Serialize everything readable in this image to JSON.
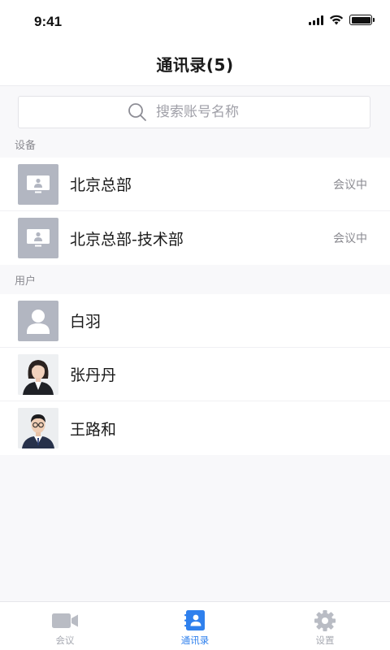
{
  "status_bar": {
    "time": "9:41"
  },
  "nav": {
    "title": "通讯录(5)"
  },
  "search": {
    "placeholder": "搜索账号名称"
  },
  "sections": {
    "devices_header": "设备",
    "users_header": "用户"
  },
  "devices": [
    {
      "name": "北京总部",
      "status": "会议中"
    },
    {
      "name": "北京总部-技术部",
      "status": "会议中"
    }
  ],
  "users": [
    {
      "name": "白羽",
      "avatar": "default-avatar"
    },
    {
      "name": "张丹丹",
      "avatar": "photo-female"
    },
    {
      "name": "王路和",
      "avatar": "photo-male"
    }
  ],
  "tabs": [
    {
      "label": "会议",
      "icon": "video-camera-icon",
      "active": false
    },
    {
      "label": "通讯录",
      "icon": "contacts-icon",
      "active": true
    },
    {
      "label": "设置",
      "icon": "gear-icon",
      "active": false
    }
  ],
  "colors": {
    "accent": "#2f80ed",
    "inactive": "#a8abb3",
    "placeholder_avatar": "#b2b6c1"
  }
}
